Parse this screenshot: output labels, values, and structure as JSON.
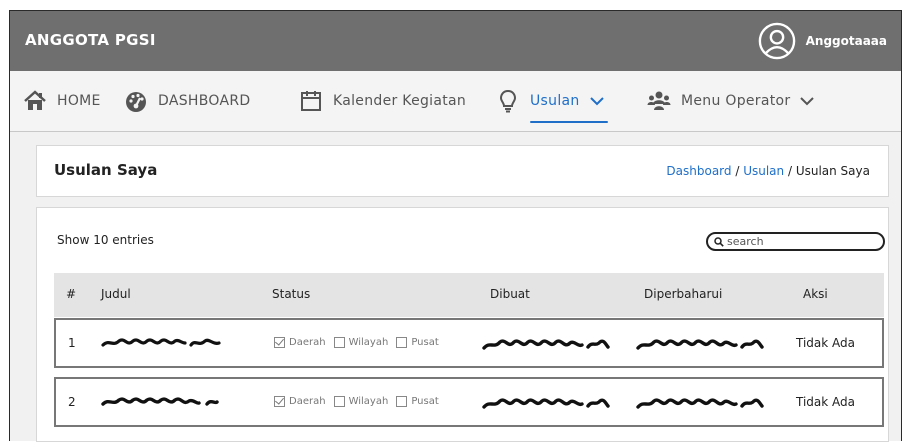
{
  "app": {
    "brand": "ANGGOTA PGSI",
    "username": "Anggotaaaa"
  },
  "nav": {
    "items": [
      {
        "label": "HOME",
        "icon": "home-icon"
      },
      {
        "label": "DASHBOARD",
        "icon": "speedometer-icon"
      },
      {
        "label": "Kalender Kegiatan",
        "icon": "calendar-icon"
      },
      {
        "label": "Usulan",
        "icon": "lightbulb-icon",
        "active": true
      },
      {
        "label": "Menu Operator",
        "icon": "users-icon"
      }
    ]
  },
  "page": {
    "title": "Usulan Saya",
    "breadcrumb": {
      "link1": "Dashboard",
      "sep": " / ",
      "link2": "Usulan",
      "current": "Usulan Saya"
    }
  },
  "table": {
    "show_entries": "Show 10 entries",
    "search_placeholder": "search",
    "headers": [
      "#",
      "Judul",
      "Status",
      "Dibuat",
      "Diperbaharui",
      "Aksi"
    ],
    "status_options": [
      "Daerah",
      "Wilayah",
      "Pusat"
    ],
    "rows": [
      {
        "no": "1",
        "daerah_checked": true,
        "wilayah_checked": false,
        "pusat_checked": false,
        "aksi": "Tidak Ada"
      },
      {
        "no": "2",
        "daerah_checked": true,
        "wilayah_checked": false,
        "pusat_checked": false,
        "aksi": "Tidak Ada"
      }
    ]
  },
  "colors": {
    "topbar": "#6f6f6f",
    "accent": "#1f6fc9",
    "header_row": "#e4e4e4"
  }
}
